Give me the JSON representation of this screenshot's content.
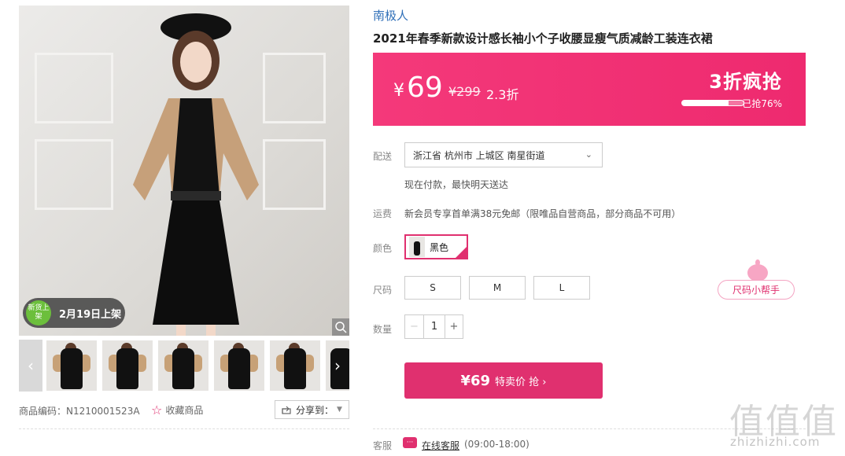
{
  "gallery": {
    "new_badge_icon": "新货上架",
    "new_badge_text": "2月19日上架",
    "thumb_count": 6
  },
  "meta": {
    "product_code": "商品编码：N1210001523A",
    "favorite_label": "收藏商品",
    "share_label": "分享到：",
    "share_icon": "share-icon"
  },
  "product": {
    "brand": "南极人",
    "title": "2021年春季新款设计感长袖小个子收腰显瘦气质减龄工装连衣裙"
  },
  "price": {
    "currency": "¥",
    "current": "69",
    "original": "¥299",
    "discount": "2.3折",
    "promo": "3折疯抢",
    "sold_label": "已抢76%",
    "sold_fraction": 0.76
  },
  "delivery": {
    "label": "配送",
    "location": "浙江省 杭州市 上城区 南星街道",
    "note": "现在付款，最快明天送达"
  },
  "shipping": {
    "label": "运费",
    "text": "新会员专享首单满38元免邮（限唯品自营商品，部分商品不可用）"
  },
  "color": {
    "label": "颜色",
    "selected": "黑色"
  },
  "size": {
    "label": "尺码",
    "options": [
      "S",
      "M",
      "L"
    ],
    "helper": "尺码小帮手"
  },
  "quantity": {
    "label": "数量",
    "minus": "−",
    "value": "1",
    "plus": "+"
  },
  "buy": {
    "price": "¥69",
    "text": "特卖价 抢 ›"
  },
  "service": {
    "label": "客服",
    "link": "在线客服",
    "hours": "(09:00-18:00)"
  },
  "watermark": {
    "big": "值值值",
    "small": "zhizhizhi.com"
  },
  "colors": {
    "accent": "#e0306f",
    "brand_link": "#2f6fb8"
  }
}
